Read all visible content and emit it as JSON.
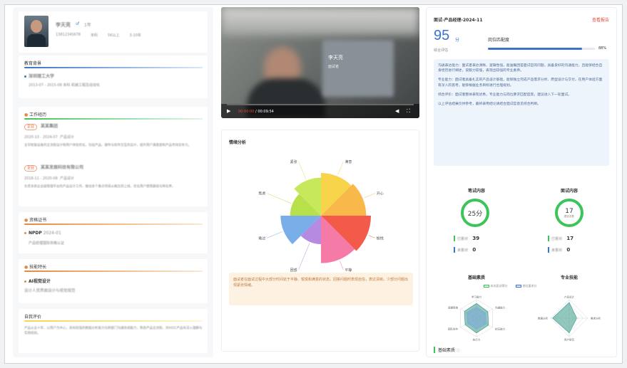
{
  "profile": {
    "name": "李天亮",
    "status": "1年",
    "info_row": [
      "13812345678",
      "本科",
      "5K以上",
      "3-10年"
    ]
  },
  "education": {
    "title": "教育背景",
    "school": "深圳理工大学",
    "detail": "2013-07 - 2015-08   本科   机械工程及自动化"
  },
  "work": {
    "title": "工作经历",
    "items": [
      {
        "tag": "企业",
        "company": "某某集团",
        "date": "2020-10 - 2024-07",
        "role": "产品设计",
        "desc": "主导智能设备的全流程设计和用户体验优化，包括产品、硬件与软件交互的设计，提升用户满意度和产品市场竞争力。"
      },
      {
        "tag": "企业",
        "company": "某某发展科技有限公司",
        "date": "2018-11 - 2020-08",
        "role": "产品设计",
        "desc": "负责多款企业级管理平台的产品设计工作，推动多个重点项目从概念到上线，优化用户使用路径与转化率。"
      }
    ]
  },
  "certs": {
    "title": "资格证书",
    "name": "NPDP",
    "date": "2024-01",
    "desc": "产品经理国际资格认证"
  },
  "skills": {
    "title": "技能特长",
    "name": "AI视觉设计",
    "desc": "设计人员界面设计与视觉规范"
  },
  "self_eval": {
    "title": "自我评价",
    "text": "产品从业十年，以用户为中心，具有较强的数据分析能力与跨部门沟通协调能力，熟悉产品全流程，对AIGC产品有深入理解与实践经验。"
  },
  "video": {
    "overlay_name": "李天亮",
    "overlay_sub": "面试者",
    "time_current": "00:00:00",
    "time_total": "00:09:54"
  },
  "emotion": {
    "title": "情绪分析",
    "labels": [
      "满意",
      "开心",
      "愉悦",
      "平静",
      "困惑",
      "难过",
      "焦虑",
      "紧张"
    ],
    "summary": "面试者在面试过程中大部分时间处于平静、愉悦和满意的状态，回答问题时表现自信，表达清晰，少部分问题出现紧张情绪。"
  },
  "report": {
    "title": "面试-产品经理-2024-11",
    "action_link": "查看报告",
    "score": "95",
    "score_unit": "分",
    "score_caption": "综合评估",
    "match_label": "岗位匹配度",
    "match_percent": 88,
    "match_text": "88%",
    "paragraphs": [
      "沟通表达能力：面试者表达清晰、逻辑性强，能准确回答面试官的问题，具备良好的沟通能力，且能够结合自身经历进行阐述，说服力较强，表现出较强的专业素养。",
      "专业能力：面试者具备扎实的产品设计基础，能够独立完成产品需求分析、原型设计与交付，在用户体验方面有深入的思考，能够根据业务目标进行合理规划。",
      "综合评价：面试者整体表现优秀，专业能力与岗位要求匹配度高，建议进入下一轮面试。"
    ],
    "footer_note": "以上评估结果仅供参考，最终录用结论请结合面试官意见综合判断。",
    "written": {
      "title": "笔试内容",
      "score": "25分",
      "correct_label": "已答对",
      "correct": "39",
      "wrong_label": "未答对",
      "wrong": "0"
    },
    "interview": {
      "title": "面试内容",
      "score": "17",
      "score_sub": "题目总数",
      "correct_label": "已答对",
      "correct": "17",
      "wrong_label": "未答对",
      "wrong": "0"
    },
    "radar_basic_title": "基础素质",
    "radar_pro_title": "专业技能",
    "legend": [
      "本次面试得分",
      "岗位要求分"
    ],
    "basic_axes": [
      "学习能力",
      "沟通能力",
      "抗压能力",
      "执行力",
      "团队协作",
      "逻辑思维"
    ],
    "pro_axes": [
      "产品设计",
      "需求分析",
      "用户研究",
      "数据分析"
    ],
    "bottom_tab": "基础素质"
  },
  "colors": {
    "accent": "#3a73c9",
    "orange": "#e58a3a",
    "green": "#3cc45a",
    "red": "#e04a3a"
  },
  "chart_data": [
    {
      "type": "pie",
      "title": "情绪分析",
      "categories": [
        "满意",
        "开心",
        "愉悦",
        "平静",
        "困惑",
        "难过",
        "焦虑",
        "紧张"
      ],
      "values": [
        90,
        95,
        105,
        100,
        60,
        85,
        65,
        80
      ],
      "colors": [
        "#f7d44a",
        "#f9b84a",
        "#f45a4a",
        "#f57aa8",
        "#b58ae0",
        "#7aaee8",
        "#b7e04a",
        "#c6e85a"
      ]
    },
    {
      "type": "radar",
      "title": "基础素质",
      "categories": [
        "学习能力",
        "沟通能力",
        "抗压能力",
        "执行力",
        "团队协作",
        "逻辑思维"
      ],
      "series": [
        {
          "name": "本次面试得分",
          "values": [
            80,
            70,
            75,
            80,
            70,
            75
          ]
        },
        {
          "name": "岗位要求分",
          "values": [
            60,
            55,
            60,
            60,
            55,
            60
          ]
        }
      ]
    },
    {
      "type": "radar",
      "title": "专业技能",
      "categories": [
        "产品设计",
        "需求分析",
        "用户研究",
        "数据分析"
      ],
      "series": [
        {
          "name": "本次面试得分",
          "values": [
            85,
            40,
            80,
            90
          ]
        }
      ]
    }
  ]
}
